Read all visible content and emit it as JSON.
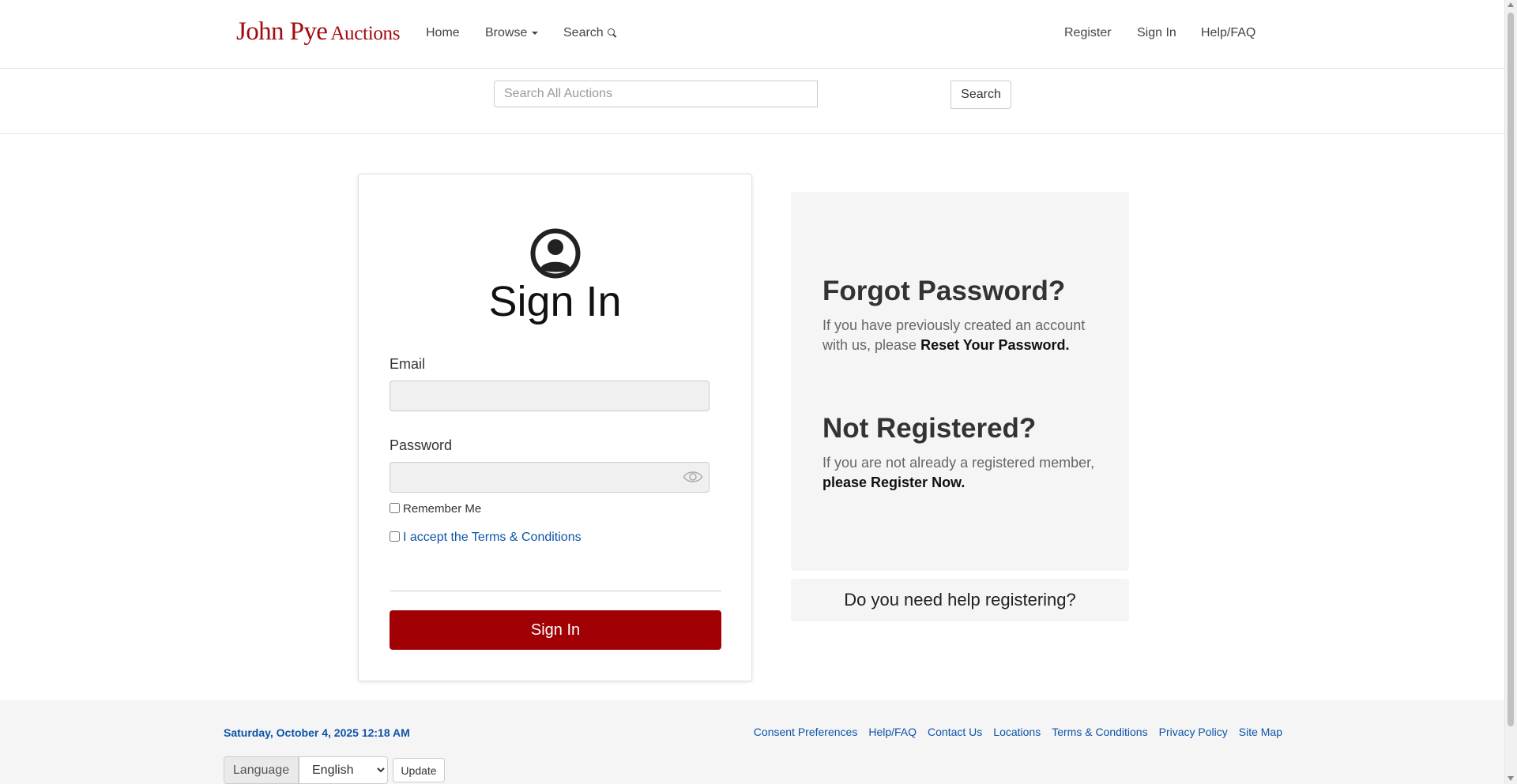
{
  "brand": {
    "name_primary": "John Pye",
    "name_secondary": "Auctions",
    "color": "#a10a0e"
  },
  "nav": {
    "home": "Home",
    "browse": "Browse",
    "search": "Search",
    "register": "Register",
    "sign_in": "Sign In",
    "help": "Help/FAQ"
  },
  "search_bar": {
    "placeholder": "Search All Auctions",
    "value": "",
    "button": "Search"
  },
  "signin_card": {
    "title": "Sign In",
    "icon": "user-circle-icon",
    "email_label": "Email",
    "email_value": "",
    "password_label": "Password",
    "password_value": "",
    "remember_label": "Remember Me",
    "remember_checked": false,
    "terms_label": "I accept the Terms & Conditions",
    "terms_checked": false,
    "submit": "Sign In",
    "accent": "#a10005"
  },
  "info_panel": {
    "forgot_heading": "Forgot Password?",
    "forgot_text": "If you have previously created an account with us, please",
    "forgot_link": "Reset Your Password.",
    "register_heading": "Not Registered?",
    "register_text": "If you are not already a registered member,",
    "register_link": "please Register Now.",
    "help_text": "Do you need help registering?"
  },
  "footer": {
    "date": "Saturday, October 4, 2025 12:18 AM",
    "links": [
      "Consent Preferences",
      "Help/FAQ",
      "Contact Us",
      "Locations",
      "Terms & Conditions",
      "Privacy Policy",
      "Site Map"
    ],
    "language_label": "Language",
    "language_value": "English",
    "update_button": "Update",
    "link_color": "#0d54a8"
  }
}
